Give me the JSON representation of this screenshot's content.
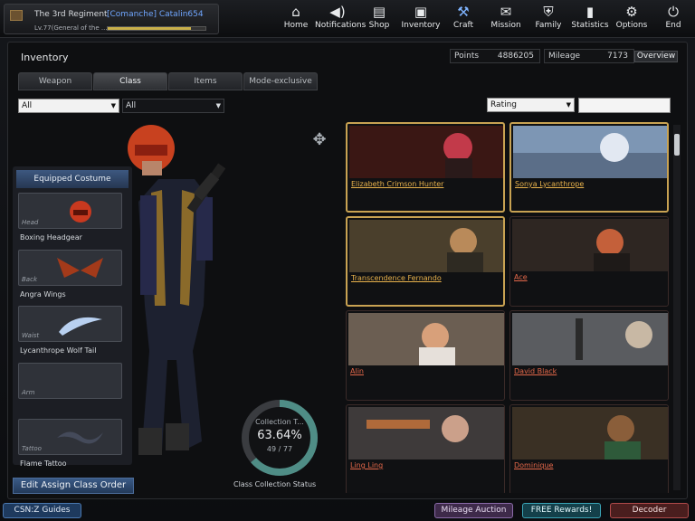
{
  "player": {
    "clan": "The 3rd Regiment",
    "tag": "[Comanche] Catalin654",
    "level": "Lv.77(General of the ...",
    "exp_fraction": 0.85
  },
  "nav": [
    {
      "label": "Home",
      "icon": "home-icon",
      "glyph": "⌂"
    },
    {
      "label": "Notifications",
      "icon": "speaker-icon",
      "glyph": "🔈"
    },
    {
      "label": "Shop",
      "icon": "shop-icon",
      "glyph": "▤"
    },
    {
      "label": "Inventory",
      "icon": "briefcase-icon",
      "glyph": "▣"
    },
    {
      "label": "Craft",
      "icon": "craft-icon",
      "glyph": "⚒"
    },
    {
      "label": "Mission",
      "icon": "mission-icon",
      "glyph": "✉"
    },
    {
      "label": "Family",
      "icon": "shield-icon",
      "glyph": "⛨"
    },
    {
      "label": "Statistics",
      "icon": "bar-chart-icon",
      "glyph": "▮"
    },
    {
      "label": "Options",
      "icon": "gear-icon",
      "glyph": "⚙"
    },
    {
      "label": "End",
      "icon": "power-icon",
      "glyph": "⏻"
    }
  ],
  "inventory": {
    "title": "Inventory",
    "points_label": "Points",
    "points": "4886205",
    "mileage_label": "Mileage",
    "mileage": "7173",
    "overview": "Overview"
  },
  "tabs": [
    "Weapon",
    "Class",
    "Items",
    "Mode-exclusive"
  ],
  "filters": {
    "left": "All",
    "middle": "All",
    "sort": "Rating"
  },
  "equipped": {
    "title": "Equipped Costume",
    "slots": [
      {
        "category": "Head",
        "name": "Boxing Headgear"
      },
      {
        "category": "Back",
        "name": "Angra Wings"
      },
      {
        "category": "Waist",
        "name": "Lycanthrope Wolf Tail"
      },
      {
        "category": "Arm",
        "name": ""
      },
      {
        "category": "Tattoo",
        "name": "Flame Tattoo"
      }
    ]
  },
  "assign_button": "Edit Assign Class Order",
  "collection": {
    "label": "Collection T...",
    "percent": "63.64%",
    "count": "49 / 77",
    "fraction": 0.6364,
    "status": "Class Collection Status"
  },
  "characters": [
    {
      "name": "Elizabeth Crimson Hunter",
      "owned": true
    },
    {
      "name": "Sonya Lycanthrope",
      "owned": true
    },
    {
      "name": "Transcendence Fernando",
      "owned": true
    },
    {
      "name": "Ace",
      "owned": false
    },
    {
      "name": "Alin",
      "owned": false
    },
    {
      "name": "David Black",
      "owned": false
    },
    {
      "name": "Ling Ling",
      "owned": false
    },
    {
      "name": "Dominique",
      "owned": false
    }
  ],
  "bottom": {
    "guides": "CSN:Z Guides",
    "auction": "Mileage Auction",
    "rewards": "FREE Rewards!",
    "decoder": "Decoder"
  }
}
